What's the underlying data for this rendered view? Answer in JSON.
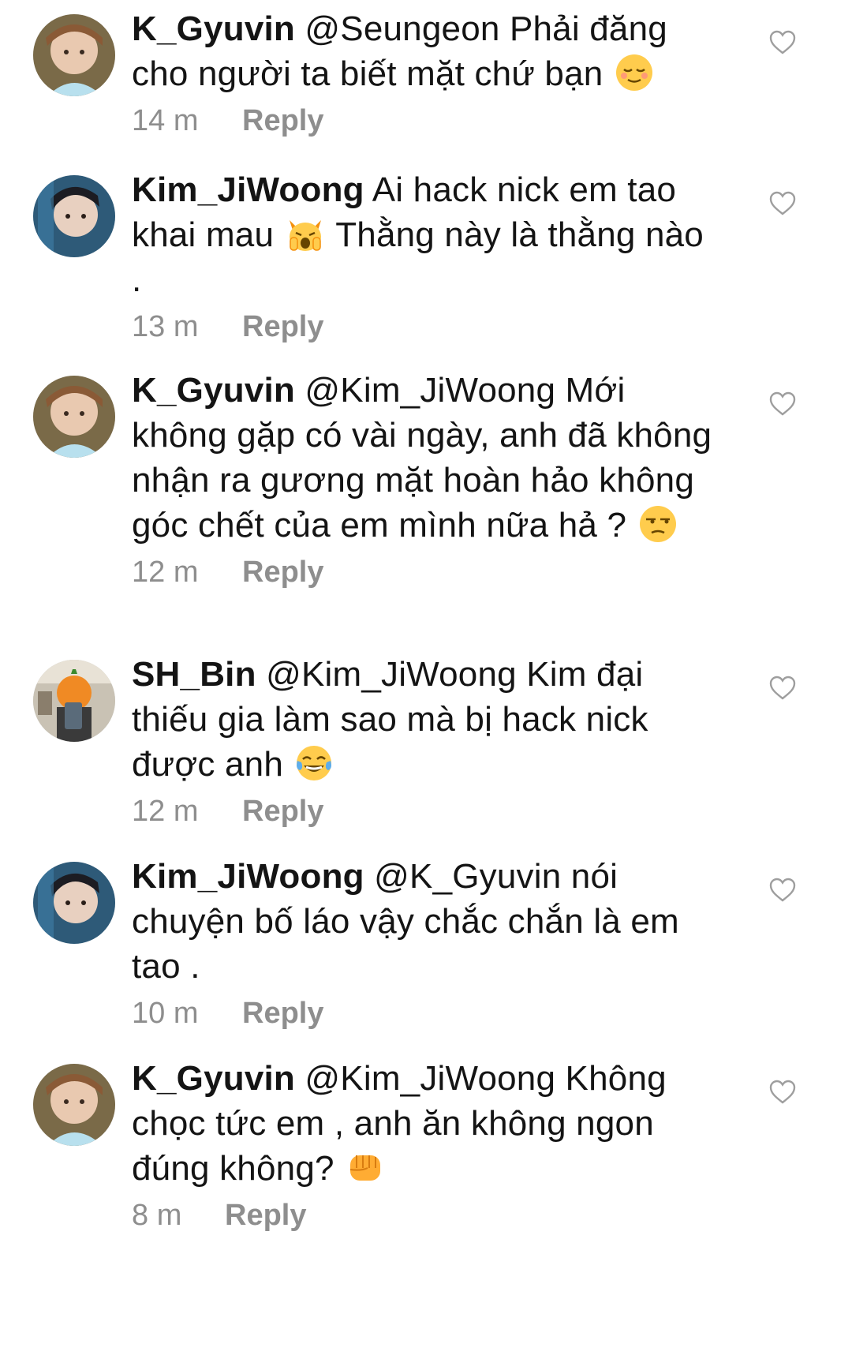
{
  "comments": [
    {
      "username": "K_Gyuvin",
      "text": " @Seungeon Phải đăng cho người ta biết mặt chứ bạn",
      "emoji": "relieved-face-emoji",
      "after_emoji": "",
      "time": "14 m",
      "reply": "Reply",
      "avatar": "k-gyuvin-avatar"
    },
    {
      "username": "Kim_JiWoong",
      "text": " Ai hack nick em tao khai mau",
      "emoji": "weary-cat-emoji",
      "after_emoji": " Thằng này là thằng nào .",
      "time": "13 m",
      "reply": "Reply",
      "avatar": "kim-jiwoong-avatar"
    },
    {
      "username": "K_Gyuvin",
      "text": " @Kim_JiWoong Mới không gặp có vài ngày, anh đã không nhận ra gương mặt hoàn hảo không góc chết của em mình nữa hả ?",
      "emoji": "unamused-face-emoji",
      "after_emoji": "",
      "time": "12 m",
      "reply": "Reply",
      "avatar": "k-gyuvin-avatar"
    },
    {
      "username": "SH_Bin",
      "text": " @Kim_JiWoong Kim đại thiếu gia làm sao mà bị hack nick được anh",
      "emoji": "tears-of-joy-emoji",
      "after_emoji": "",
      "time": "12 m",
      "reply": "Reply",
      "avatar": "sh-bin-avatar"
    },
    {
      "username": "Kim_JiWoong",
      "text": " @K_Gyuvin nói chuyện bố láo vậy chắc chắn là em tao .",
      "emoji": "",
      "after_emoji": "",
      "time": "10 m",
      "reply": "Reply",
      "avatar": "kim-jiwoong-avatar"
    },
    {
      "username": "K_Gyuvin",
      "text": " @Kim_JiWoong Không chọc tức em , anh ăn không ngon đúng không?",
      "emoji": "oncoming-fist-emoji",
      "after_emoji": "",
      "time": "8 m",
      "reply": "Reply",
      "avatar": "k-gyuvin-avatar"
    }
  ],
  "colors": {
    "text": "#141414",
    "meta": "#8e8e8e",
    "like_outline": "#9e9e9e",
    "background": "#ffffff"
  },
  "icons": {
    "like": "heart-outline-icon"
  }
}
